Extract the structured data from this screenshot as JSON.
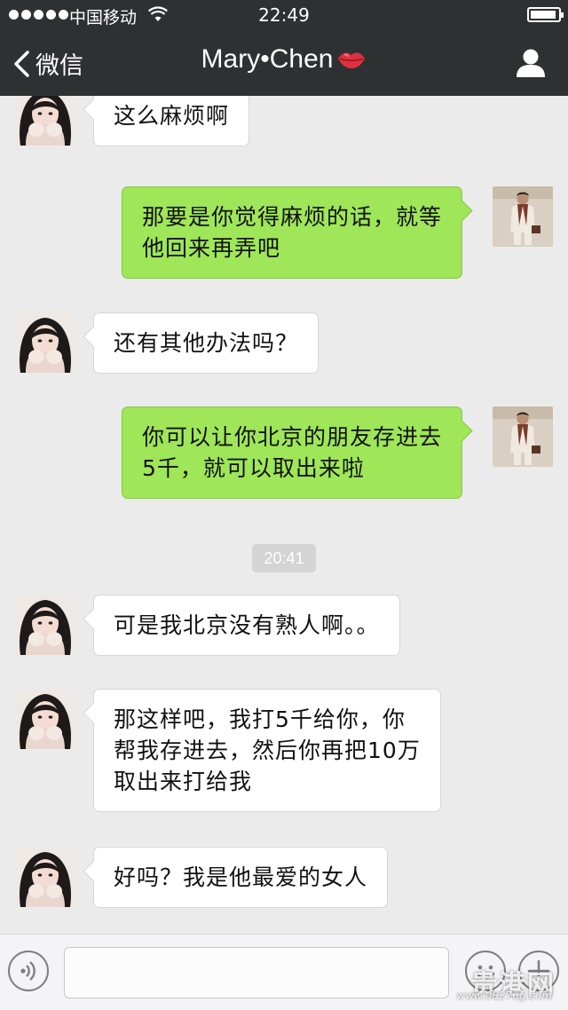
{
  "status_bar": {
    "carrier": "中国移动",
    "time": "22:49"
  },
  "nav": {
    "back_label": "微信",
    "title": "Mary•Chen"
  },
  "colors": {
    "topbar": "#2e3132",
    "chat_background": "#ebebeb",
    "outgoing_bubble": "#9fe658",
    "incoming_bubble": "#ffffff"
  },
  "messages": [
    {
      "side": "in",
      "text": "这么麻烦啊"
    },
    {
      "side": "out",
      "text": "那要是你觉得麻烦的话，就等\n他回来再弄吧"
    },
    {
      "side": "in",
      "text": "还有其他办法吗？"
    },
    {
      "side": "out",
      "text": "你可以让你北京的朋友存进去\n5千，就可以取出来啦"
    },
    {
      "side": "in",
      "text": "可是我北京没有熟人啊。。"
    },
    {
      "side": "in",
      "text": "那这样吧，我打5千给你，你\n帮我存进去，然后你再把10万\n取出来打给我"
    },
    {
      "side": "in",
      "text": "好吗？我是他最爱的女人"
    }
  ],
  "timestamp": "20:41",
  "input": {
    "value": ""
  },
  "watermark": {
    "logo_text": "贵港网",
    "url_text": "www.0827ug.com"
  }
}
